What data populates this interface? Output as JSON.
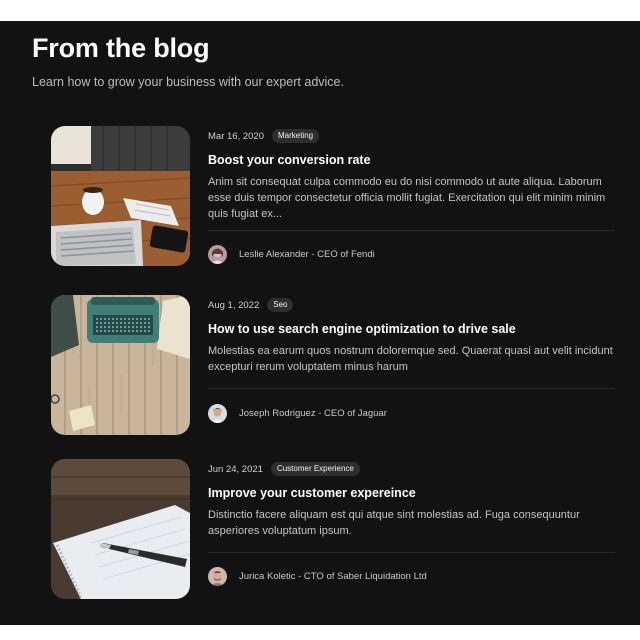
{
  "header": {
    "title": "From the blog",
    "subtitle": "Learn how to grow your business with our expert advice."
  },
  "posts": [
    {
      "date": "Mar 16, 2020",
      "category": "Marketing",
      "title": "Boost your conversion rate",
      "excerpt": "Anim sit consequat culpa commodo eu do nisi commodo ut aute aliqua. Laborum esse duis tempor consectetur officia mollit fugiat. Exercitation qui elit minim minim quis fugiat ex...",
      "author": "Leslie Alexander - CEO of Fendi"
    },
    {
      "date": "Aug 1, 2022",
      "category": "Seo",
      "title": "How to use search engine optimization to drive sale",
      "excerpt": "Molestias ea earum quos nostrum doloremque sed. Quaerat quasi aut velit incidunt excepturi rerum voluptatem minus harum",
      "author": "Joseph Rodriguez - CEO of Jaguar"
    },
    {
      "date": "Jun 24, 2021",
      "category": "Customer Experience",
      "title": "Improve your customer expereince",
      "excerpt": "Distinctio facere aliquam est qui atque sint molestias ad. Fuga consequuntur asperiores voluptatum ipsum.",
      "author": "Jurica Koletic - CTO of Saber Liquidation Ltd"
    }
  ]
}
